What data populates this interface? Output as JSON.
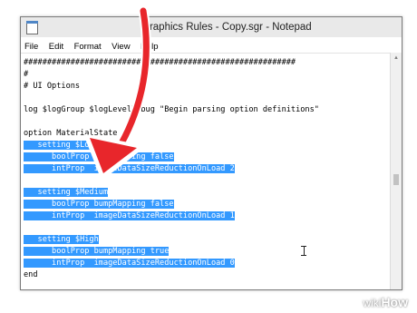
{
  "window": {
    "title": "Graphics Rules - Copy.sgr - Notepad"
  },
  "menu": [
    "File",
    "Edit",
    "Format",
    "View",
    "Help"
  ],
  "editor": {
    "lines": [
      {
        "text": "##########################################################",
        "selected": false
      },
      {
        "text": "#",
        "selected": false
      },
      {
        "text": "# UI Options",
        "selected": false
      },
      {
        "text": "",
        "selected": false
      },
      {
        "text": "log $logGroup $logLevelDebug \"Begin parsing option definitions\"",
        "selected": false
      },
      {
        "text": "",
        "selected": false
      },
      {
        "text": "option MaterialState",
        "selected": false
      },
      {
        "text": "   setting $Low",
        "selected": true
      },
      {
        "text": "      boolProp bumpMapping false",
        "selected": true
      },
      {
        "text": "      intProp  imageDataSizeReductionOnLoad 2",
        "selected": true
      },
      {
        "text": "",
        "selected": false
      },
      {
        "text": "   setting $Medium",
        "selected": true
      },
      {
        "text": "      boolProp bumpMapping false",
        "selected": true
      },
      {
        "text": "      intProp  imageDataSizeReductionOnLoad 1",
        "selected": true
      },
      {
        "text": "",
        "selected": false
      },
      {
        "text": "   setting $High",
        "selected": true
      },
      {
        "text": "      boolProp bumpMapping true",
        "selected": true
      },
      {
        "text": "      intProp  imageDataSizeReductionOnLoad 0",
        "selected": true
      },
      {
        "text": "end",
        "selected": false
      }
    ]
  },
  "watermark": {
    "prefix": "wiki",
    "suffix": "How"
  },
  "colors": {
    "selection": "#3399ff",
    "arrow": "#e8262b"
  }
}
